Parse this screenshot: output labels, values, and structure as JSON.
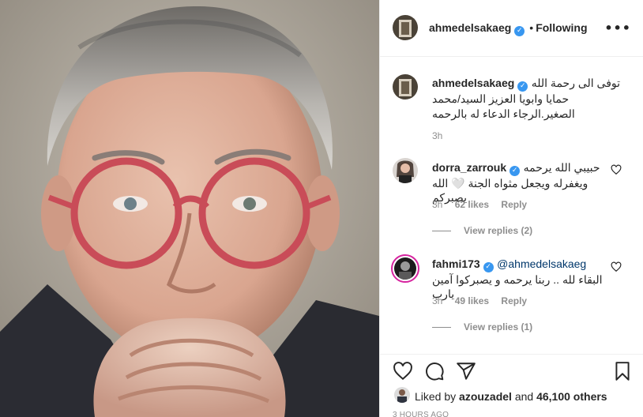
{
  "header": {
    "username": "ahmedelsakaeg",
    "verified_glyph": "✓",
    "separator": "•",
    "follow_label": "Following",
    "more_icon": "more-horizontal-icon",
    "more_glyph": "•••"
  },
  "caption": {
    "username": "ahmedelsakaeg",
    "text": "توفى الى رحمة الله حمايا وابويا العزيز السيد/محمد الصغير.الرجاء الدعاء له بالرحمه",
    "time": "3h"
  },
  "comments": [
    {
      "username": "dorra_zarrouk",
      "line1": "حبيبي الله يرحمه",
      "line2": "ويغفرله ويجعل مثواه الجنة 🤍 الله يصبركم",
      "time": "3h",
      "likes": "62 likes",
      "reply_label": "Reply",
      "view_replies": "View replies (2)"
    },
    {
      "username": "fahmi173",
      "mention": "@ahmedelsakaeg",
      "line2": "البقاء لله .. ربنا يرحمه و يصبركوا آمين يارب",
      "time": "3h",
      "likes": "49 likes",
      "reply_label": "Reply",
      "view_replies": "View replies (1)"
    }
  ],
  "actions": {
    "icons": [
      "heart-icon",
      "comment-icon",
      "share-icon",
      "bookmark-icon"
    ]
  },
  "likes": {
    "prefix": "Liked by",
    "user": "azouzadel",
    "middle": "and",
    "count": "46,100 others"
  },
  "time_ago": "3 HOURS AGO",
  "colors": {
    "text": "#262626",
    "muted": "#8e8e8e",
    "link": "#00376b",
    "verified": "#3897f0",
    "border": "#efefef"
  }
}
